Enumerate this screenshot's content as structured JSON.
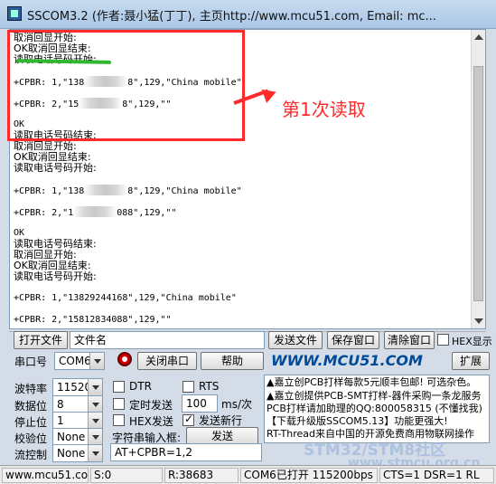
{
  "window": {
    "title": "SSCOM3.2 (作者:聂小猛(丁丁), 主页http://www.mcu51.com,  Email: mc..."
  },
  "terminal": {
    "lines": [
      "取消回显开始:",
      "OK取消回显结束:",
      "读取电话号码开始:",
      "+CPBR: 1,\"138",
      "8\",129,\"China mobile\"",
      "+CPBR: 2,\"15",
      "8\",129,\"\"",
      "OK",
      "读取电话号码结束:",
      "取消回显开始:",
      "OK取消回显结束:",
      "读取电话号码开始:",
      "+CPBR: 1,\"138",
      "8\",129,\"China mobile\"",
      "+CPBR: 2,\"1",
      "088\",129,\"\"",
      "OK",
      "读取电话号码结束:",
      "取消回显开始:",
      "OK取消回显结束:",
      "读取电话号码开始:",
      "+CPBR: 1,\"13829244168\",129,\"China mobile\"",
      "+CPBR: 2,\"15812834088\",129,\"\""
    ]
  },
  "annotation": {
    "label": "第1次读取",
    "color": "#ff2a2a",
    "underline_color": "#2fb82f"
  },
  "toolbar": {
    "open_file": "打开文件",
    "file_name": "文件名",
    "send_file": "发送文件",
    "save_window": "保存窗口",
    "clear_window": "清除窗口",
    "hex_display": "HEX显示"
  },
  "port": {
    "label": "串口号",
    "value": "COM6",
    "close_port": "关闭串口",
    "help": "帮助",
    "logo": "WWW.MCU51.COM",
    "expand": "扩展"
  },
  "settings": {
    "baud_label": "波特率",
    "baud_value": "115200",
    "data_label": "数据位",
    "data_value": "8",
    "stop_label": "停止位",
    "stop_value": "1",
    "parity_label": "校验位",
    "parity_value": "None",
    "flow_label": "流控制",
    "flow_value": "None"
  },
  "options": {
    "dtr": "DTR",
    "rts": "RTS",
    "timed_send": "定时发送",
    "interval_value": "100",
    "interval_unit": "ms/次",
    "hex_send": "HEX发送",
    "send_newline": "发送新行",
    "input_label": "字符串输入框:",
    "send_button": "发送",
    "input_value": "AT+CPBR=1,2"
  },
  "ads": [
    "▲嘉立创PCB打样每款5元顺丰包邮! 可选杂色。",
    "▲嘉立创提供PCB-SMT打样-器件采购一条龙服务",
    "PCB打样请加助理的QQ:800058315 (不懂找我)",
    "【下载升级版SSCOM5.13】功能更强大!",
    "RT-Thread来自中国的开源免费商用物联网操作"
  ],
  "watermark": {
    "line1": "STM32/STM8社区",
    "line2": "www.stmcu.org.cn"
  },
  "status": {
    "site": "www.mcu51.cor",
    "sent": "S:0",
    "received": "R:38683",
    "port_state": "COM6已打开  115200bps",
    "signals": "CTS=1 DSR=1 RL"
  }
}
